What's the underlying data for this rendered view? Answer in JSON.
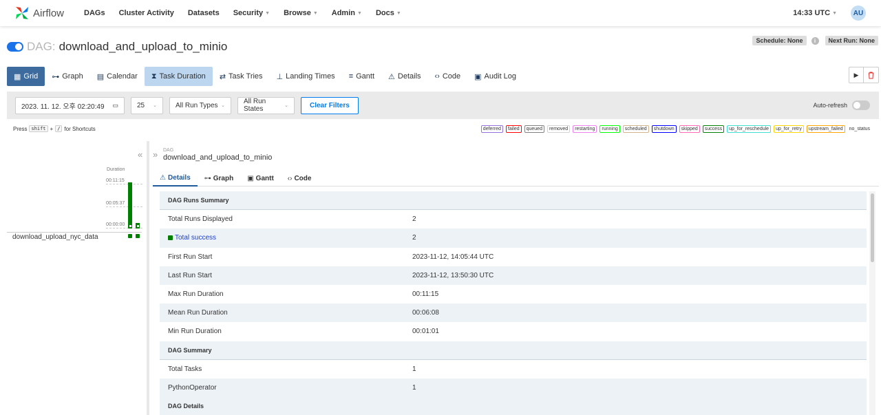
{
  "nav": {
    "brand": "Airflow",
    "items": [
      {
        "label": "DAGs",
        "caret": false
      },
      {
        "label": "Cluster Activity",
        "caret": false
      },
      {
        "label": "Datasets",
        "caret": false
      },
      {
        "label": "Security",
        "caret": true
      },
      {
        "label": "Browse",
        "caret": true
      },
      {
        "label": "Admin",
        "caret": true
      },
      {
        "label": "Docs",
        "caret": true
      }
    ],
    "time": "14:33 UTC",
    "user_initials": "AU"
  },
  "dag": {
    "prefix": "DAG:",
    "name": "download_and_upload_to_minio",
    "schedule": "Schedule: None",
    "next_run": "Next Run: None"
  },
  "view_tabs": [
    "Grid",
    "Graph",
    "Calendar",
    "Task Duration",
    "Task Tries",
    "Landing Times",
    "Gantt",
    "Details",
    "Code",
    "Audit Log"
  ],
  "filters": {
    "datetime": "2023. 11. 12. 오후 02:20:49",
    "run_count": "25",
    "run_types": "All Run Types",
    "run_states": "All Run States",
    "clear": "Clear Filters",
    "auto_refresh": "Auto-refresh"
  },
  "shortcut": {
    "press": "Press",
    "key1": "shift",
    "plus": "+",
    "key2": "/",
    "suffix": "for Shortcuts"
  },
  "legend": [
    {
      "label": "deferred",
      "color": "#9370db"
    },
    {
      "label": "failed",
      "color": "#ff0000"
    },
    {
      "label": "queued",
      "color": "#808080"
    },
    {
      "label": "removed",
      "color": "#d3d3d3"
    },
    {
      "label": "restarting",
      "color": "#ee82ee"
    },
    {
      "label": "running",
      "color": "#00ff00"
    },
    {
      "label": "scheduled",
      "color": "#d2b48c"
    },
    {
      "label": "shutdown",
      "color": "#0000ff"
    },
    {
      "label": "skipped",
      "color": "#ff69b4"
    },
    {
      "label": "success",
      "color": "#008000"
    },
    {
      "label": "up_for_reschedule",
      "color": "#40e0d0"
    },
    {
      "label": "up_for_retry",
      "color": "#ffd700"
    },
    {
      "label": "upstream_failed",
      "color": "#ffa500"
    },
    {
      "label": "no_status",
      "color": ""
    }
  ],
  "grid": {
    "duration_label": "Duration",
    "ticks": [
      "00:11:15",
      "00:05:37",
      "00:00:00"
    ],
    "runs": [
      {
        "duration_s": 675
      },
      {
        "duration_s": 61
      }
    ],
    "max_duration_s": 675,
    "task_name": "download_upload_nyc_data"
  },
  "details": {
    "breadcrumb_label": "DAG",
    "breadcrumb_title": "download_and_upload_to_minio",
    "subtabs": [
      "Details",
      "Graph",
      "Gantt",
      "Code"
    ],
    "rows": [
      {
        "type": "head",
        "label": "DAG Runs Summary",
        "value": ""
      },
      {
        "type": "row",
        "label": "Total Runs Displayed",
        "value": "2"
      },
      {
        "type": "link",
        "label": "Total success",
        "value": "2"
      },
      {
        "type": "row",
        "label": "First Run Start",
        "value": "2023-11-12, 14:05:44 UTC"
      },
      {
        "type": "row",
        "label": "Last Run Start",
        "value": "2023-11-12, 13:50:30 UTC"
      },
      {
        "type": "row",
        "label": "Max Run Duration",
        "value": "00:11:15"
      },
      {
        "type": "row",
        "label": "Mean Run Duration",
        "value": "00:06:08"
      },
      {
        "type": "row",
        "label": "Min Run Duration",
        "value": "00:01:01"
      },
      {
        "type": "head",
        "label": "DAG Summary",
        "value": ""
      },
      {
        "type": "row",
        "label": "Total Tasks",
        "value": "1"
      },
      {
        "type": "row",
        "label": "PythonOperator",
        "value": "1"
      },
      {
        "type": "head",
        "label": "DAG Details",
        "value": ""
      }
    ]
  }
}
